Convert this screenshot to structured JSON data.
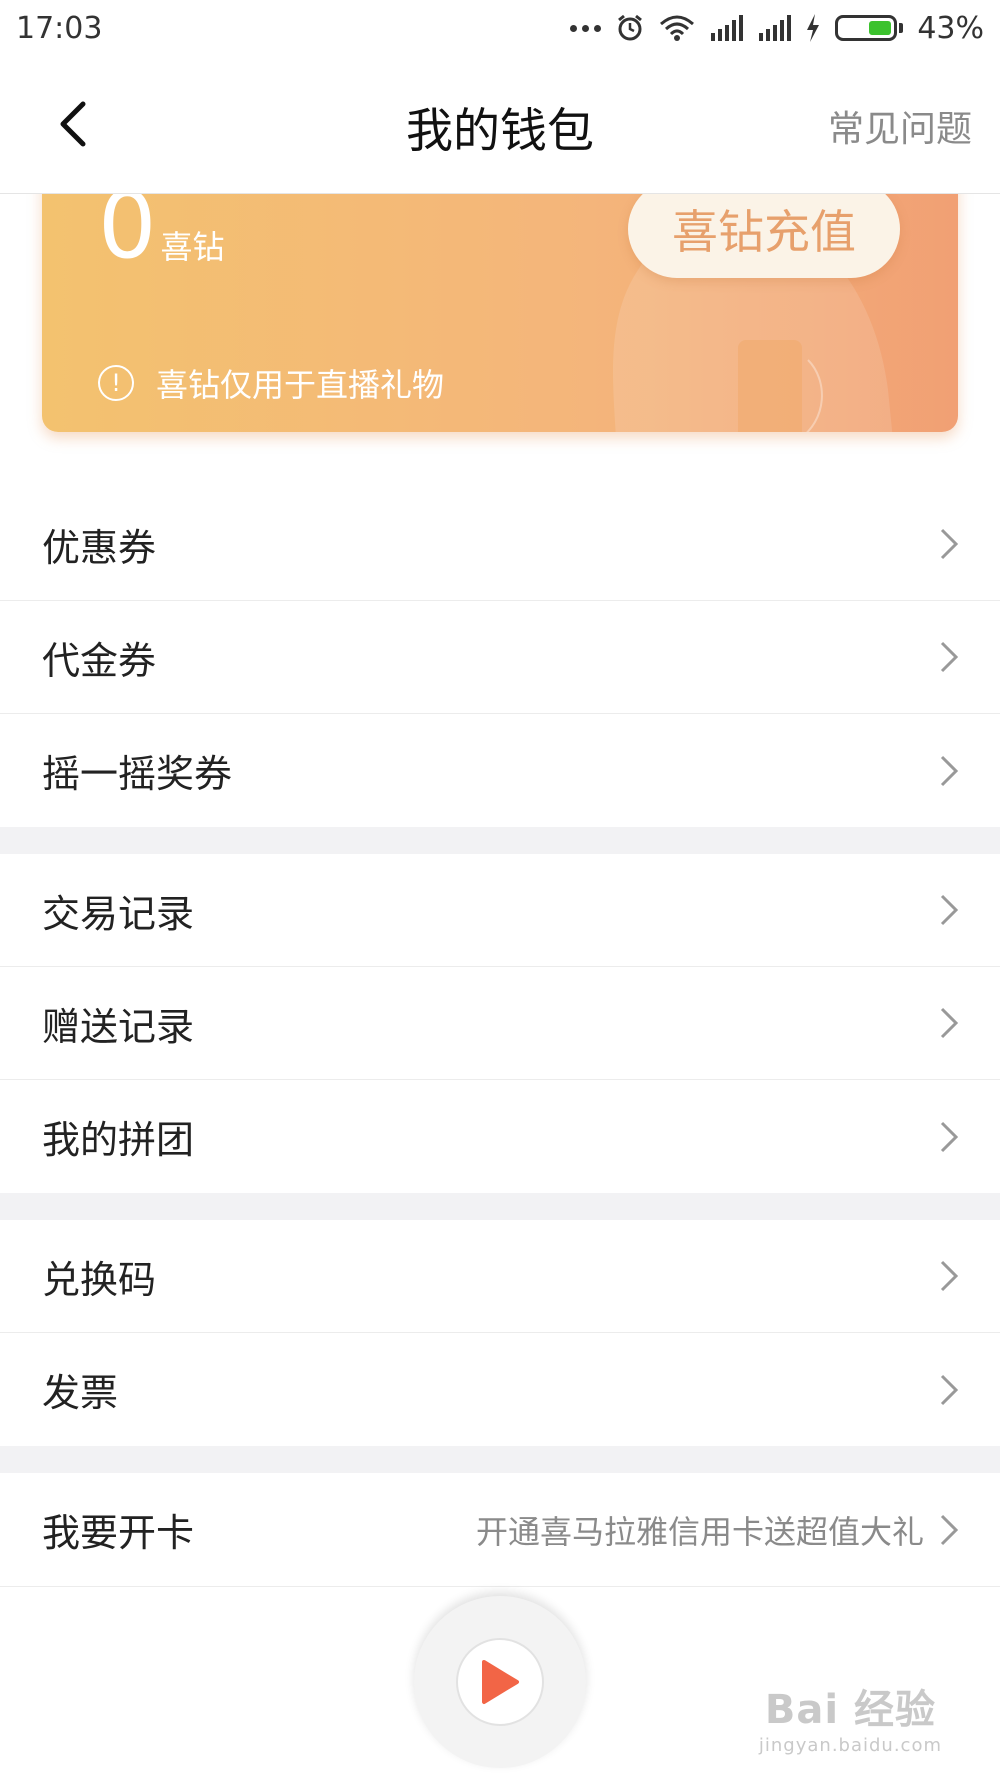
{
  "status_bar": {
    "time": "17:03",
    "battery_percent": "43%",
    "battery_level": 0.43,
    "icons": [
      "more-dots-icon",
      "alarm-icon",
      "wifi-icon",
      "signal-icon",
      "signal-icon",
      "charging-icon",
      "battery-icon"
    ]
  },
  "nav": {
    "title": "我的钱包",
    "faq_label": "常见问题"
  },
  "wallet": {
    "balance": "0",
    "unit": "喜钻",
    "recharge_label": "喜钻充值",
    "note": "喜钻仅用于直播礼物"
  },
  "sections": [
    {
      "items": [
        {
          "label": "优惠券"
        },
        {
          "label": "代金券"
        },
        {
          "label": "摇一摇奖券"
        }
      ]
    },
    {
      "items": [
        {
          "label": "交易记录"
        },
        {
          "label": "赠送记录"
        },
        {
          "label": "我的拼团"
        }
      ]
    },
    {
      "items": [
        {
          "label": "兑换码"
        },
        {
          "label": "发票"
        }
      ]
    },
    {
      "items": [
        {
          "label": "我要开卡",
          "sub": "开通喜马拉雅信用卡送超值大礼"
        }
      ]
    }
  ],
  "watermark": {
    "main": "Bai 经验",
    "sub": "jingyan.baidu.com"
  },
  "colors": {
    "card_start": "#f3c26f",
    "card_end": "#f1a074",
    "play_accent": "#f26546"
  }
}
